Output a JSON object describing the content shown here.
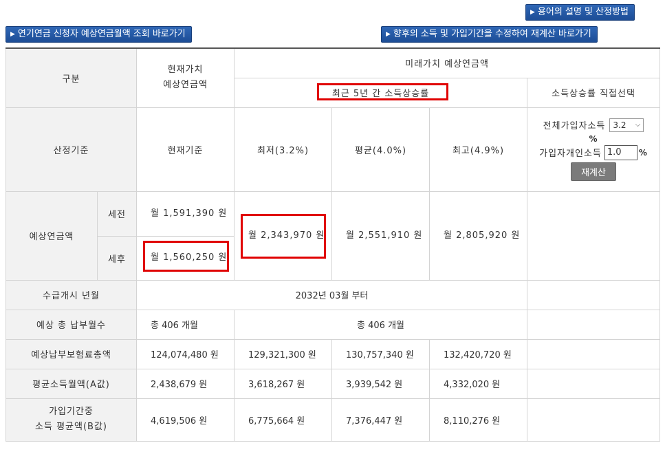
{
  "buttons": {
    "glossary": "용어의 설명 및 산정방법",
    "lookup": "연기연금 신청자 예상연금월액 조회 바로가기",
    "recalc_link": "향후의 소득 및 가입기간을 수정하여 재계산 바로가기"
  },
  "header": {
    "category": "구분",
    "present_value": "현재가치\n예상연금액",
    "future_value": "미래가치 예상연금액",
    "recent_rate": "최근 5년 간 소득상승률",
    "custom_rate": "소득상승률 직접선택"
  },
  "criteria": {
    "label": "산정기준",
    "current": "현재기준",
    "low": "최저(3.2%)",
    "avg": "평균(4.0%)",
    "high": "최고(4.9%)"
  },
  "controls": {
    "all_income_label": "전체가입자소득",
    "all_income_value": "3.2",
    "percent1": "%",
    "personal_income_label": "가입자개인소득",
    "personal_income_value": "1.0",
    "percent2": "%",
    "recalc_button": "재계산"
  },
  "pension": {
    "label": "예상연금액",
    "pretax": "세전",
    "posttax": "세후",
    "current_pretax": "월 1,591,390 원",
    "current_posttax": "월 1,560,250 원",
    "low": "월 2,343,970 원",
    "avg": "월 2,551,910 원",
    "high": "월 2,805,920 원"
  },
  "start": {
    "label": "수급개시 년월",
    "value": "2032년 03월 부터"
  },
  "months": {
    "label": "예상 총 납부월수",
    "current": "총 406 개월",
    "future": "총 406 개월"
  },
  "premium": {
    "label": "예상납부보험료총액",
    "current": "124,074,480 원",
    "low": "129,321,300 원",
    "avg": "130,757,340 원",
    "high": "132,420,720 원"
  },
  "a_value": {
    "label": "평균소득월액(A값)",
    "current": "2,438,679 원",
    "low": "3,618,267 원",
    "avg": "3,939,542 원",
    "high": "4,332,020 원"
  },
  "b_value": {
    "label": "가입기간중\n소득 평균액(B값)",
    "current": "4,619,506 원",
    "low": "6,775,664 원",
    "avg": "7,376,447 원",
    "high": "8,110,276 원"
  }
}
